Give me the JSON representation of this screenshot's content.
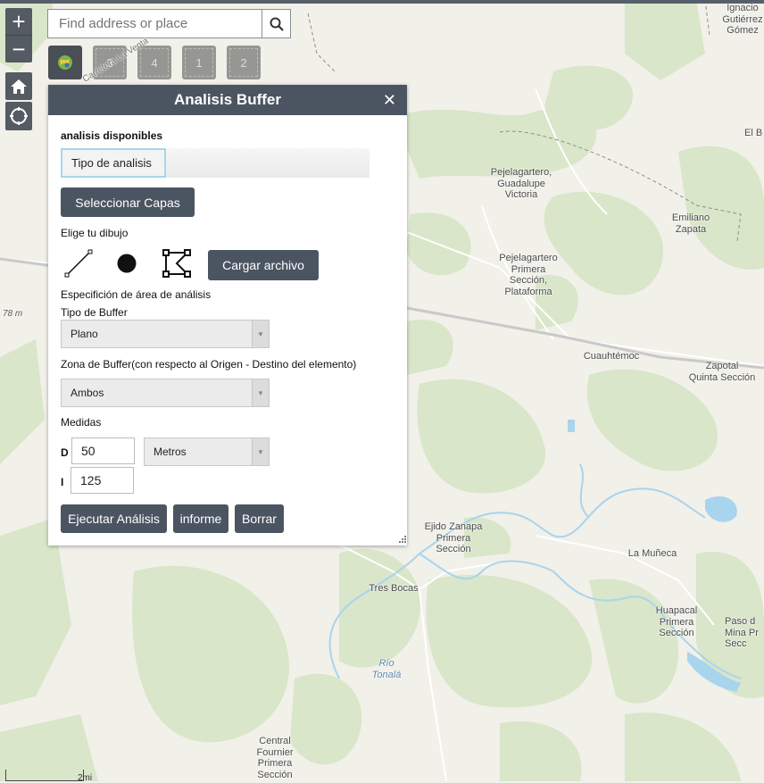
{
  "search": {
    "placeholder": "Find address or place"
  },
  "toolbar": {
    "buttons": [
      "",
      "3",
      "4",
      "1",
      "2"
    ]
  },
  "panel": {
    "title": "Analisis Buffer",
    "available_label": "analisis disponibles",
    "tab_label": "Tipo de analisis",
    "select_layers_btn": "Seleccionar Capas",
    "draw_label": "Elige tu dibujo",
    "load_file_btn": "Cargar archivo",
    "area_spec_label": "Especifición de área de análisis",
    "buffer_type_label": "Tipo de Buffer",
    "buffer_type_value": "Plano",
    "buffer_zone_label": "Zona de Buffer(con respecto al Origen - Destino del elemento)",
    "buffer_zone_value": "Ambos",
    "measures_label": "Medidas",
    "d_label": "D",
    "d_value": "50",
    "i_label": "I",
    "i_value": "125",
    "unit_value": "Metros",
    "run_btn": "Ejecutar Análisis",
    "report_btn": "informe",
    "clear_btn": "Borrar"
  },
  "map_labels": [
    "Ignacio\nGutiérrez\nGómez",
    "El B",
    "Pejelagartero,\nGuadalupe\nVictoria",
    "Emiliano\nZapata",
    "Pejelagartero\nPrimera\nSección,\nPlataforma",
    "Cuauhtémoc",
    "Zapotal\nQuinta Sección",
    "Ejido Zanapa\nPrimera\nSección",
    "La Muñeca",
    "Tres Bocas",
    "Huapacal\nPrimera\nSección",
    "Paso d\nMina Pr\nSecc",
    "Central\nFournier\nPrimera\nSección"
  ],
  "road_label": "Carretera La Venta",
  "river_label": "Río\nTonalá",
  "elevation_label": "78 m",
  "scale_label": "2mi"
}
